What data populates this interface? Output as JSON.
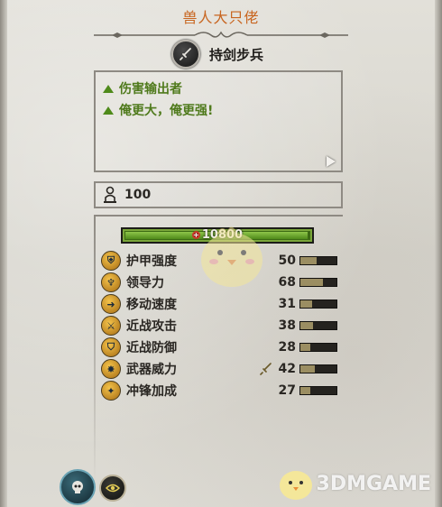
{
  "unit": {
    "name": "兽人大只佬",
    "type_label": "持剑步兵",
    "type_icon": "sword-icon"
  },
  "traits": [
    {
      "label": "伤害输出者",
      "icon": "triangle-up-icon"
    },
    {
      "label": "俺更大，俺更强!",
      "icon": "triangle-up-icon"
    }
  ],
  "unit_count": "100",
  "hit_points": {
    "label": "10800",
    "fill_fraction": 0.99
  },
  "stats": [
    {
      "key": "armour",
      "label": "护甲强度",
      "value": "50",
      "fill": 0.45,
      "icon": "armour-icon"
    },
    {
      "key": "leadership",
      "label": "领导力",
      "value": "68",
      "fill": 0.62,
      "icon": "leadership-icon"
    },
    {
      "key": "speed",
      "label": "移动速度",
      "value": "31",
      "fill": 0.32,
      "icon": "speed-icon"
    },
    {
      "key": "melee_attack",
      "label": "近战攻击",
      "value": "38",
      "fill": 0.36,
      "icon": "melee-attack-icon"
    },
    {
      "key": "melee_defence",
      "label": "近战防御",
      "value": "28",
      "fill": 0.28,
      "icon": "melee-defence-icon"
    },
    {
      "key": "weapon_strength",
      "label": "武器威力",
      "value": "42",
      "fill": 0.4,
      "icon": "weapon-strength-icon",
      "bonus_icon": "bonus-sword-icon"
    },
    {
      "key": "charge_bonus",
      "label": "冲锋加成",
      "value": "27",
      "fill": 0.27,
      "icon": "charge-bonus-icon"
    }
  ],
  "watermark": {
    "text": "3DMGAME"
  },
  "colors": {
    "title": "#c8651f",
    "trait_green": "#4f7a1c",
    "hp_green": "#4f8a1a"
  }
}
